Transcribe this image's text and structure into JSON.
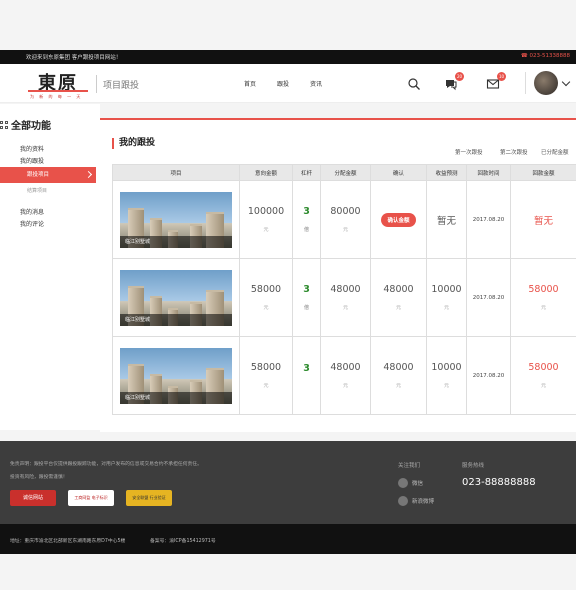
{
  "topbar": {
    "welcome": "欢迎来到东原集团 客户跟投项目网站！",
    "phone": "☎ 023-51338888"
  },
  "header": {
    "logo_text": "東原",
    "logo_slogan": "为 新 的 每 一 天",
    "section_title": "项目跟投",
    "nav": [
      "首页",
      "跟投",
      "资讯"
    ],
    "icons": [
      "search-icon",
      "message-icon",
      "mail-icon",
      "avatar",
      "chevron-down-icon"
    ],
    "message_badge": "20",
    "mail_badge": "10"
  },
  "sidebar": {
    "title": "全部功能",
    "items": [
      "我的资料",
      "我的跟投",
      "我的消息",
      "我的评论"
    ],
    "active_sub": "跟投项目",
    "sub_item": "结算项目"
  },
  "main": {
    "title": "我的跟投",
    "filter_tabs": [
      "第一次跟投",
      "第二次跟投",
      "已分配金额"
    ],
    "columns": [
      "项目",
      "意向金额",
      "杠杆",
      "分配金额",
      "确认",
      "收益预测",
      "回款时间",
      "回款金额"
    ],
    "rows": [
      {
        "project": "临江别墅城",
        "intent": "100000",
        "intent_unit": "元",
        "leverage": "3",
        "leverage_unit": "倍",
        "allocated": "80000",
        "allocated_unit": "元",
        "confirm_button": "确认金额",
        "forecast": "暂无",
        "payback_date": "2017.08.20",
        "payback_amount": "暂无"
      },
      {
        "project": "临江别墅城",
        "intent": "58000",
        "intent_unit": "元",
        "leverage": "3",
        "leverage_unit": "倍",
        "allocated": "48000",
        "allocated_unit": "元",
        "confirmed": "48000",
        "confirmed_unit": "元",
        "forecast": "10000",
        "forecast_unit": "元",
        "payback_date": "2017.08.20",
        "payback_amount": "58000",
        "payback_unit": "元"
      },
      {
        "project": "临江别墅城",
        "intent": "58000",
        "intent_unit": "元",
        "leverage": "3",
        "allocated": "48000",
        "allocated_unit": "元",
        "confirmed": "48000",
        "confirmed_unit": "元",
        "forecast": "10000",
        "forecast_unit": "元",
        "payback_date": "2017.08.20",
        "payback_amount": "58000",
        "payback_unit": "元"
      }
    ]
  },
  "footer": {
    "disclaimer_1": "免责声明：跟投平台仅提供跟投跟踪功能，对用户发布的信息或交易合约不承担任何责任。",
    "disclaimer_2": "投资有风险，跟投需谨慎！",
    "seal_1": "诚信网站",
    "seal_2": "工商网监 电子标识",
    "seal_3": "安全联盟 行业验证",
    "follow_title": "关注我们",
    "wechat": "微信",
    "weibo": "新浪微博",
    "service_title": "服务热线",
    "hotline": "023-88888888",
    "address": "地址：重庆市渝北区北部新区东湖南路东原D7中心5楼",
    "icp": "备案号：渝ICP备15412971号"
  },
  "colors": {
    "accent": "#e8524a",
    "leverage": "#2e8b2e"
  }
}
